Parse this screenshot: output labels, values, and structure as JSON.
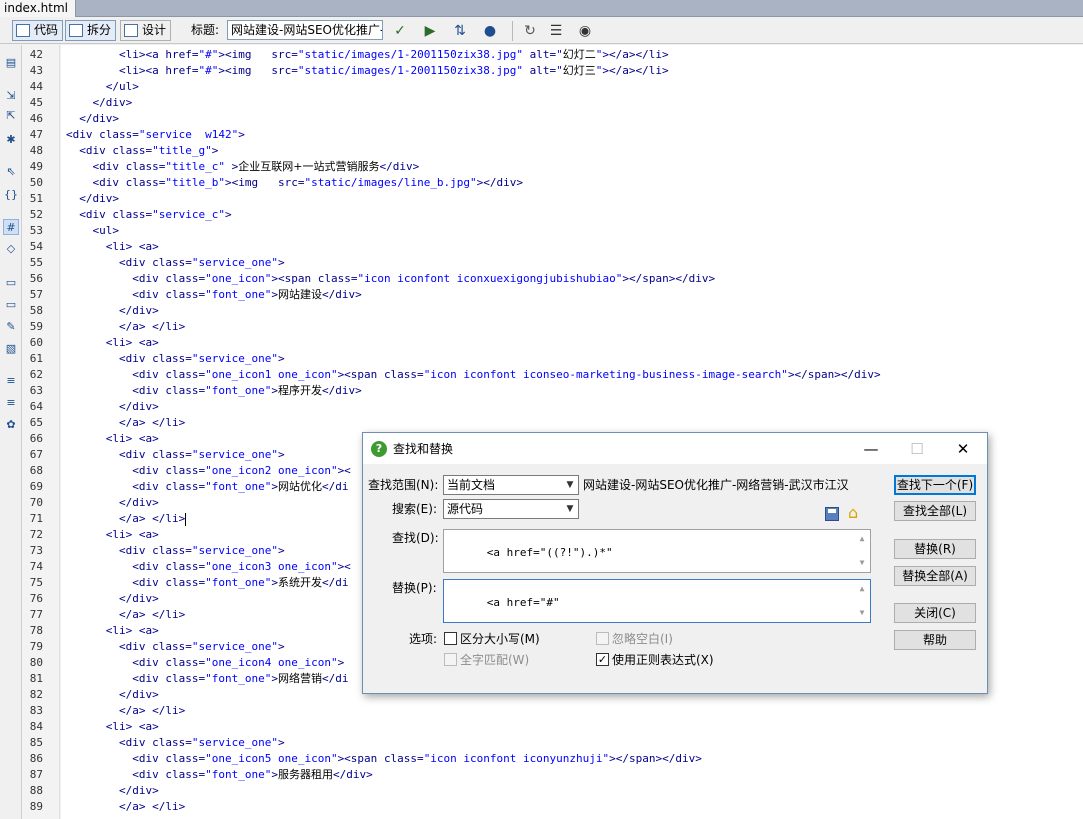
{
  "tab": {
    "filename": "index.html"
  },
  "toolbar": {
    "code_label": "代码",
    "split_label": "拆分",
    "design_label": "设计",
    "title_label": "标题:",
    "title_value": "网站建设-网站SEO优化推广-"
  },
  "lines": [
    {
      "n": "42",
      "html": "        <span class='t'>&lt;li&gt;&lt;a</span> <span class='a'>href=</span><span class='v'>\"#\"</span><span class='t'>&gt;&lt;img</span>   <span class='a'>src=</span><span class='v'>\"static/images/1-2001150zix38.jpg\"</span> <span class='a'>alt=</span><span class='v'>\"</span><span class='tx'>幻灯二</span><span class='v'>\"</span><span class='t'>&gt;&lt;/a&gt;&lt;/li&gt;</span>"
    },
    {
      "n": "43",
      "html": "        <span class='t'>&lt;li&gt;&lt;a</span> <span class='a'>href=</span><span class='v'>\"#\"</span><span class='t'>&gt;&lt;img</span>   <span class='a'>src=</span><span class='v'>\"static/images/1-2001150zix38.jpg\"</span> <span class='a'>alt=</span><span class='v'>\"</span><span class='tx'>幻灯三</span><span class='v'>\"</span><span class='t'>&gt;&lt;/a&gt;&lt;/li&gt;</span>"
    },
    {
      "n": "44",
      "html": "      <span class='t'>&lt;/ul&gt;</span>"
    },
    {
      "n": "45",
      "html": "    <span class='t'>&lt;/div&gt;</span>"
    },
    {
      "n": "46",
      "html": "  <span class='t'>&lt;/div&gt;</span>"
    },
    {
      "n": "47",
      "html": "<span class='t'>&lt;div</span> <span class='a'>class=</span><span class='v'>\"service  w142\"</span><span class='t'>&gt;</span>"
    },
    {
      "n": "48",
      "html": "  <span class='t'>&lt;div</span> <span class='a'>class=</span><span class='v'>\"title_g\"</span><span class='t'>&gt;</span>"
    },
    {
      "n": "49",
      "html": "    <span class='t'>&lt;div</span> <span class='a'>class=</span><span class='v'>\"title_c\"</span> <span class='t'>&gt;</span><span class='tx'>企业互联网+一站式营销服务</span><span class='t'>&lt;/div&gt;</span>"
    },
    {
      "n": "50",
      "html": "    <span class='t'>&lt;div</span> <span class='a'>class=</span><span class='v'>\"title_b\"</span><span class='t'>&gt;&lt;img</span>   <span class='a'>src=</span><span class='v'>\"static/images/line_b.jpg\"</span><span class='t'>&gt;&lt;/div&gt;</span>"
    },
    {
      "n": "51",
      "html": "  <span class='t'>&lt;/div&gt;</span>"
    },
    {
      "n": "52",
      "html": "  <span class='t'>&lt;div</span> <span class='a'>class=</span><span class='v'>\"service_c\"</span><span class='t'>&gt;</span>"
    },
    {
      "n": "53",
      "html": "    <span class='t'>&lt;ul&gt;</span>"
    },
    {
      "n": "54",
      "html": "      <span class='t'>&lt;li&gt;</span> <span class='t'>&lt;a&gt;</span>"
    },
    {
      "n": "55",
      "html": "        <span class='t'>&lt;div</span> <span class='a'>class=</span><span class='v'>\"service_one\"</span><span class='t'>&gt;</span>"
    },
    {
      "n": "56",
      "html": "          <span class='t'>&lt;div</span> <span class='a'>class=</span><span class='v'>\"one_icon\"</span><span class='t'>&gt;&lt;span</span> <span class='a'>class=</span><span class='v'>\"icon iconfont iconxuexigongjubishubiao\"</span><span class='t'>&gt;&lt;/span&gt;&lt;/div&gt;</span>"
    },
    {
      "n": "57",
      "html": "          <span class='t'>&lt;div</span> <span class='a'>class=</span><span class='v'>\"font_one\"</span><span class='t'>&gt;</span><span class='tx'>网站建设</span><span class='t'>&lt;/div&gt;</span>"
    },
    {
      "n": "58",
      "html": "        <span class='t'>&lt;/div&gt;</span>"
    },
    {
      "n": "59",
      "html": "        <span class='t'>&lt;/a&gt;</span> <span class='t'>&lt;/li&gt;</span>"
    },
    {
      "n": "60",
      "html": "      <span class='t'>&lt;li&gt;</span> <span class='t'>&lt;a&gt;</span>"
    },
    {
      "n": "61",
      "html": "        <span class='t'>&lt;div</span> <span class='a'>class=</span><span class='v'>\"service_one\"</span><span class='t'>&gt;</span>"
    },
    {
      "n": "62",
      "html": "          <span class='t'>&lt;div</span> <span class='a'>class=</span><span class='v'>\"one_icon1 one_icon\"</span><span class='t'>&gt;&lt;span</span> <span class='a'>class=</span><span class='v'>\"icon iconfont iconseo-marketing-business-image-search\"</span><span class='t'>&gt;&lt;/span&gt;&lt;/div&gt;</span>"
    },
    {
      "n": "63",
      "html": "          <span class='t'>&lt;div</span> <span class='a'>class=</span><span class='v'>\"font_one\"</span><span class='t'>&gt;</span><span class='tx'>程序开发</span><span class='t'>&lt;/div&gt;</span>"
    },
    {
      "n": "64",
      "html": "        <span class='t'>&lt;/div&gt;</span>"
    },
    {
      "n": "65",
      "html": "        <span class='t'>&lt;/a&gt;</span> <span class='t'>&lt;/li&gt;</span>"
    },
    {
      "n": "66",
      "html": "      <span class='t'>&lt;li&gt;</span> <span class='t'>&lt;a&gt;</span>"
    },
    {
      "n": "67",
      "html": "        <span class='t'>&lt;div</span> <span class='a'>class=</span><span class='v'>\"service_one\"</span><span class='t'>&gt;</span>"
    },
    {
      "n": "68",
      "html": "          <span class='t'>&lt;div</span> <span class='a'>class=</span><span class='v'>\"one_icon2 one_icon\"</span><span class='t'>&gt;&lt;</span>"
    },
    {
      "n": "69",
      "html": "          <span class='t'>&lt;div</span> <span class='a'>class=</span><span class='v'>\"font_one\"</span><span class='t'>&gt;</span><span class='tx'>网站优化</span><span class='t'>&lt;/di</span>"
    },
    {
      "n": "70",
      "html": "        <span class='t'>&lt;/div&gt;</span>"
    },
    {
      "n": "71",
      "html": "        <span class='t'>&lt;/a&gt;</span> <span class='t'>&lt;/li&gt;</span><span class='caret'></span>"
    },
    {
      "n": "72",
      "html": "      <span class='t'>&lt;li&gt;</span> <span class='t'>&lt;a&gt;</span>"
    },
    {
      "n": "73",
      "html": "        <span class='t'>&lt;div</span> <span class='a'>class=</span><span class='v'>\"service_one\"</span><span class='t'>&gt;</span>"
    },
    {
      "n": "74",
      "html": "          <span class='t'>&lt;div</span> <span class='a'>class=</span><span class='v'>\"one_icon3 one_icon\"</span><span class='t'>&gt;&lt;</span>"
    },
    {
      "n": "75",
      "html": "          <span class='t'>&lt;div</span> <span class='a'>class=</span><span class='v'>\"font_one\"</span><span class='t'>&gt;</span><span class='tx'>系统开发</span><span class='t'>&lt;/di</span>"
    },
    {
      "n": "76",
      "html": "        <span class='t'>&lt;/div&gt;</span>"
    },
    {
      "n": "77",
      "html": "        <span class='t'>&lt;/a&gt;</span> <span class='t'>&lt;/li&gt;</span>"
    },
    {
      "n": "78",
      "html": "      <span class='t'>&lt;li&gt;</span> <span class='t'>&lt;a&gt;</span>"
    },
    {
      "n": "79",
      "html": "        <span class='t'>&lt;div</span> <span class='a'>class=</span><span class='v'>\"service_one\"</span><span class='t'>&gt;</span>"
    },
    {
      "n": "80",
      "html": "          <span class='t'>&lt;div</span> <span class='a'>class=</span><span class='v'>\"one_icon4 one_icon\"</span><span class='t'>&gt;</span>"
    },
    {
      "n": "81",
      "html": "          <span class='t'>&lt;div</span> <span class='a'>class=</span><span class='v'>\"font_one\"</span><span class='t'>&gt;</span><span class='tx'>网络营销</span><span class='t'>&lt;/di</span>"
    },
    {
      "n": "82",
      "html": "        <span class='t'>&lt;/div&gt;</span>"
    },
    {
      "n": "83",
      "html": "        <span class='t'>&lt;/a&gt;</span> <span class='t'>&lt;/li&gt;</span>"
    },
    {
      "n": "84",
      "html": "      <span class='t'>&lt;li&gt;</span> <span class='t'>&lt;a&gt;</span>"
    },
    {
      "n": "85",
      "html": "        <span class='t'>&lt;div</span> <span class='a'>class=</span><span class='v'>\"service_one\"</span><span class='t'>&gt;</span>"
    },
    {
      "n": "86",
      "html": "          <span class='t'>&lt;div</span> <span class='a'>class=</span><span class='v'>\"one_icon5 one_icon\"</span><span class='t'>&gt;&lt;span</span> <span class='a'>class=</span><span class='v'>\"icon iconfont iconyunzhuji\"</span><span class='t'>&gt;&lt;/span&gt;&lt;/div&gt;</span>"
    },
    {
      "n": "87",
      "html": "          <span class='t'>&lt;div</span> <span class='a'>class=</span><span class='v'>\"font_one\"</span><span class='t'>&gt;</span><span class='tx'>服务器租用</span><span class='t'>&lt;/div&gt;</span>"
    },
    {
      "n": "88",
      "html": "        <span class='t'>&lt;/div&gt;</span>"
    },
    {
      "n": "89",
      "html": "        <span class='t'>&lt;/a&gt;</span> <span class='t'>&lt;/li&gt;</span>"
    }
  ],
  "dialog": {
    "title": "查找和替换",
    "scope_label": "查找范围(N):",
    "scope_value": "当前文档",
    "scope_doc_title": "网站建设-网站SEO优化推广-网络营销-武汉市江汉",
    "search_label": "搜索(E):",
    "search_value": "源代码",
    "find_label": "查找(D):",
    "find_value": "<a href=\"((?!\").)*\"",
    "replace_label": "替换(P):",
    "replace_value": "<a href=\"#\"",
    "options_label": "选项:",
    "opt_match_case": "区分大小写(M)",
    "opt_ignore_ws": "忽略空白(I)",
    "opt_whole_word": "全字匹配(W)",
    "opt_regex": "使用正则表达式(X)",
    "btn_find_next": "查找下一个(F)",
    "btn_find_all": "查找全部(L)",
    "btn_replace": "替换(R)",
    "btn_replace_all": "替换全部(A)",
    "btn_close": "关闭(C)",
    "btn_help": "帮助"
  }
}
